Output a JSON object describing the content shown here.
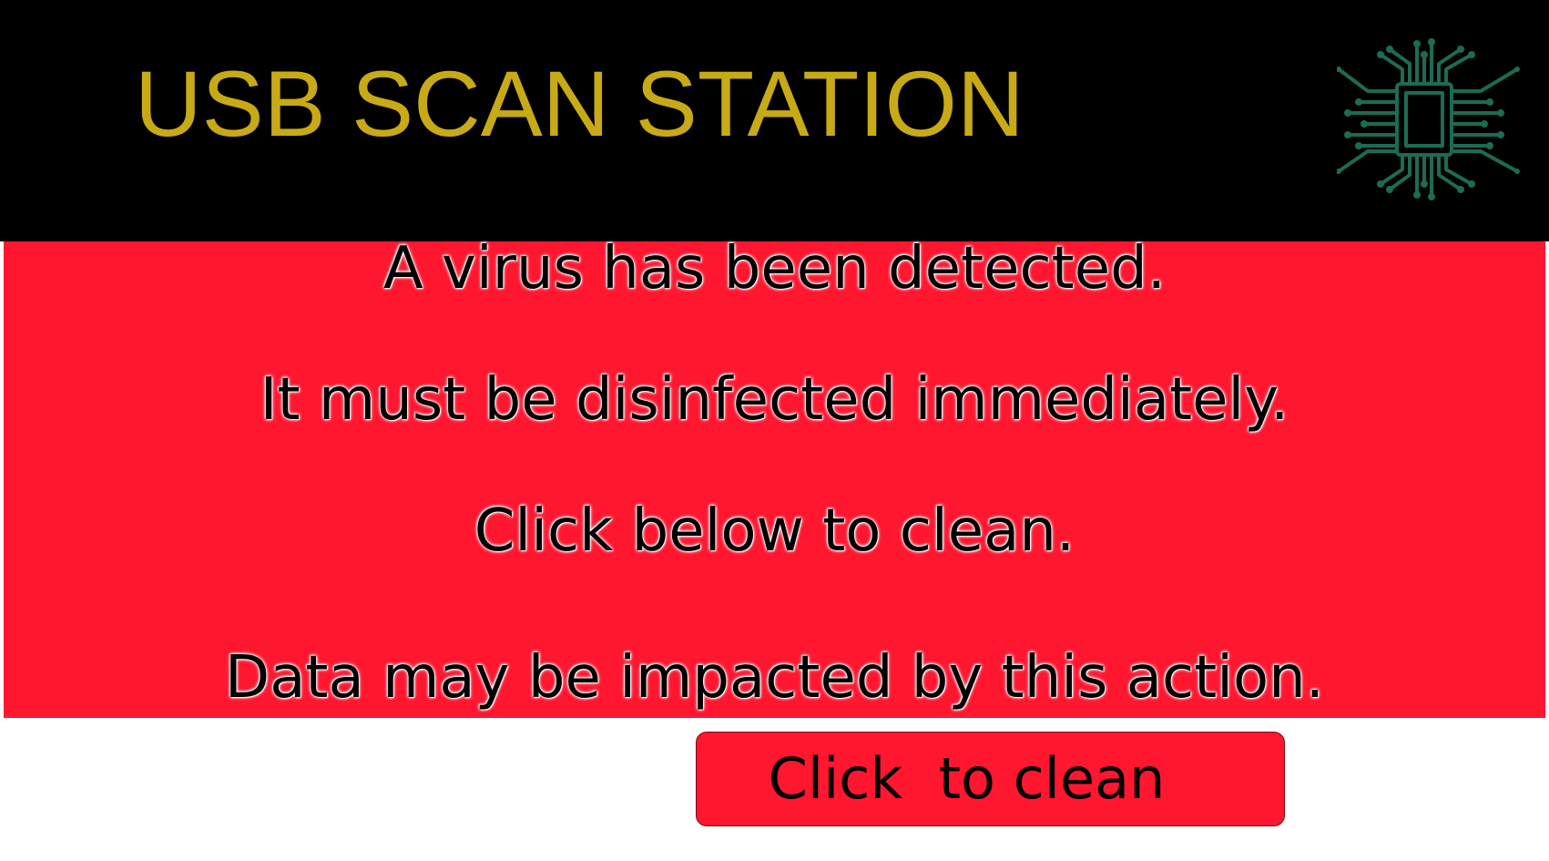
{
  "header": {
    "title": "USB SCAN STATION",
    "icon": "circuit-chip-icon"
  },
  "alert": {
    "lines": [
      "A virus has been detected.",
      "It must be disinfected immediately.",
      "Click below to clean.",
      "Data may be impacted by this action."
    ]
  },
  "action": {
    "button_label": "Click  to clean"
  },
  "colors": {
    "header_background": "#000000",
    "title_text": "#c8aa16",
    "alert_background": "#ff1730",
    "button_background": "#ff1730",
    "icon_color": "#1c6b55",
    "page_background": "#ffffff"
  }
}
